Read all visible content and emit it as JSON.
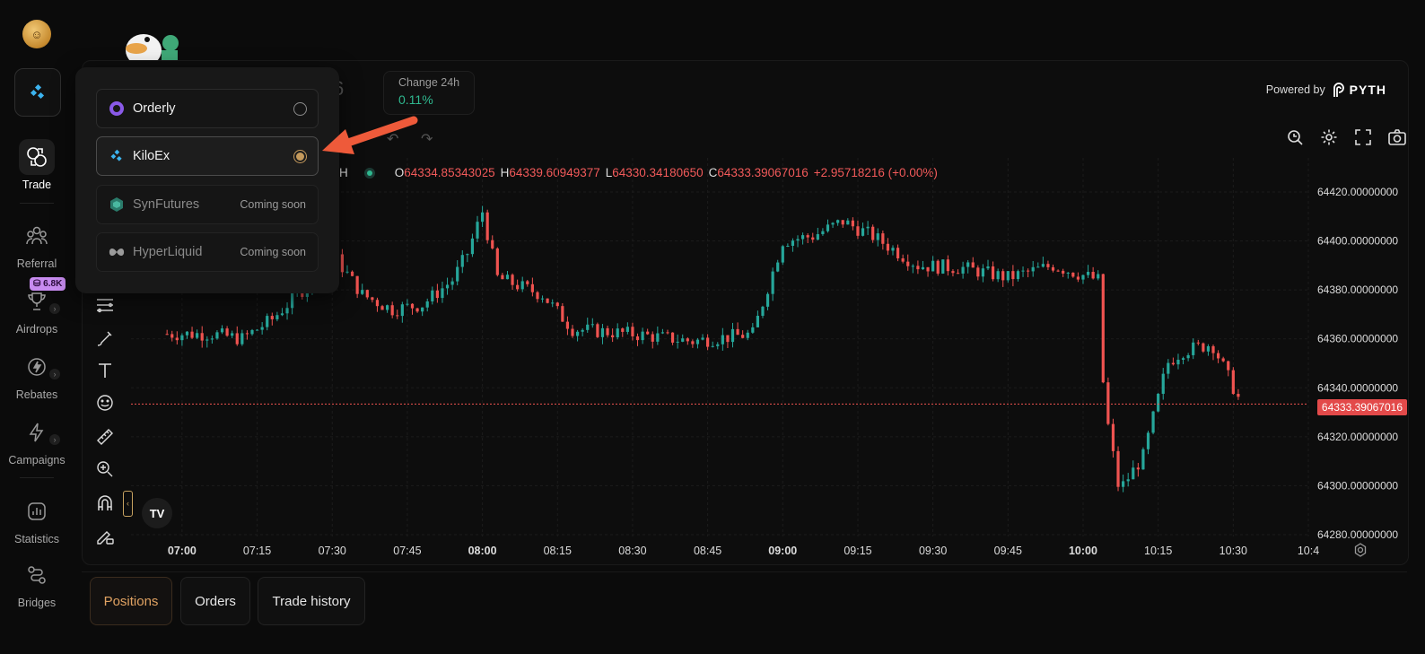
{
  "sidebar": {
    "items": [
      {
        "label": "Trade",
        "icon": "trade-icon",
        "active": true
      },
      {
        "label": "Referral",
        "icon": "referral-icon"
      },
      {
        "label": "Airdrops",
        "icon": "trophy-icon",
        "badge": "6.8K"
      },
      {
        "label": "Rebates",
        "icon": "lightning-icon"
      },
      {
        "label": "Campaigns",
        "icon": "campaign-icon"
      },
      {
        "label": "Statistics",
        "icon": "statistics-icon"
      },
      {
        "label": "Bridges",
        "icon": "bridge-icon"
      }
    ]
  },
  "market_stats": {
    "change_label": "Change 24h",
    "change_value": "0.11%",
    "partial_price_digit": "6"
  },
  "powered_by": {
    "label": "Powered by",
    "brand": "PYTH"
  },
  "ohlc": {
    "interval_suffix": "H",
    "open_key": "O",
    "open": "64334.85343025",
    "high_key": "H",
    "high": "64339.60949377",
    "low_key": "L",
    "low": "64330.34180650",
    "close_key": "C",
    "close": "64333.39067016",
    "change": "+2.95718216 (+0.00%)"
  },
  "chart_data": {
    "type": "candlestick",
    "y_ticks": [
      "64420.00000000",
      "64400.00000000",
      "64380.00000000",
      "64360.00000000",
      "64340.00000000",
      "64320.00000000",
      "64300.00000000",
      "64280.00000000"
    ],
    "x_ticks": [
      "07:00",
      "07:15",
      "07:30",
      "07:45",
      "08:00",
      "08:15",
      "08:30",
      "08:45",
      "09:00",
      "09:15",
      "09:30",
      "09:45",
      "10:00",
      "10:15",
      "10:30",
      "10:4"
    ],
    "bold_x_ticks": [
      "07:00",
      "08:00",
      "09:00",
      "10:00"
    ],
    "ylim": [
      64280,
      64420
    ],
    "last_price": "64333.39067016",
    "close_path": [
      [
        6.95,
        64362
      ],
      [
        7.1,
        64362
      ],
      [
        7.2,
        64360
      ],
      [
        7.3,
        64368
      ],
      [
        7.4,
        64380
      ],
      [
        7.5,
        64395
      ],
      [
        7.6,
        64378
      ],
      [
        7.7,
        64372
      ],
      [
        7.8,
        64374
      ],
      [
        7.9,
        64384
      ],
      [
        7.95,
        64395
      ],
      [
        8.0,
        64412
      ],
      [
        8.05,
        64385
      ],
      [
        8.2,
        64378
      ],
      [
        8.3,
        64364
      ],
      [
        8.5,
        64362
      ],
      [
        8.7,
        64359
      ],
      [
        8.9,
        64362
      ],
      [
        9.0,
        64400
      ],
      [
        9.1,
        64402
      ],
      [
        9.2,
        64408
      ],
      [
        9.3,
        64402
      ],
      [
        9.45,
        64390
      ],
      [
        9.6,
        64389
      ],
      [
        9.75,
        64385
      ],
      [
        9.9,
        64390
      ],
      [
        10.05,
        64384
      ],
      [
        10.07,
        64334
      ],
      [
        10.12,
        64298
      ],
      [
        10.2,
        64312
      ],
      [
        10.28,
        64350
      ],
      [
        10.33,
        64355
      ],
      [
        10.43,
        64358
      ],
      [
        10.52,
        64335
      ]
    ],
    "colors": {
      "up": "#26a69a",
      "down": "#ef5350",
      "last_price_line": "#ef5350"
    }
  },
  "chart_tools_top": [
    "search-zoom-icon",
    "settings-gear-icon",
    "fullscreen-icon",
    "camera-icon"
  ],
  "drawing_tools": [
    "fib-lines-icon",
    "brush-icon",
    "text-tool-icon",
    "emoji-icon",
    "ruler-icon",
    "zoom-in-icon",
    "magnet-icon",
    "lock-draw-icon"
  ],
  "exchange_dropdown": {
    "options": [
      {
        "label": "Orderly",
        "icon": "orderly-icon",
        "selected": false
      },
      {
        "label": "KiloEx",
        "icon": "kiloex-icon",
        "selected": true
      },
      {
        "label": "SynFutures",
        "icon": "synfutures-icon",
        "status": "Coming soon"
      },
      {
        "label": "HyperLiquid",
        "icon": "hyperliquid-icon",
        "status": "Coming soon"
      }
    ]
  },
  "bottom_tabs": [
    {
      "label": "Positions",
      "active": true
    },
    {
      "label": "Orders"
    },
    {
      "label": "Trade history"
    }
  ],
  "tv_logo": "TV"
}
